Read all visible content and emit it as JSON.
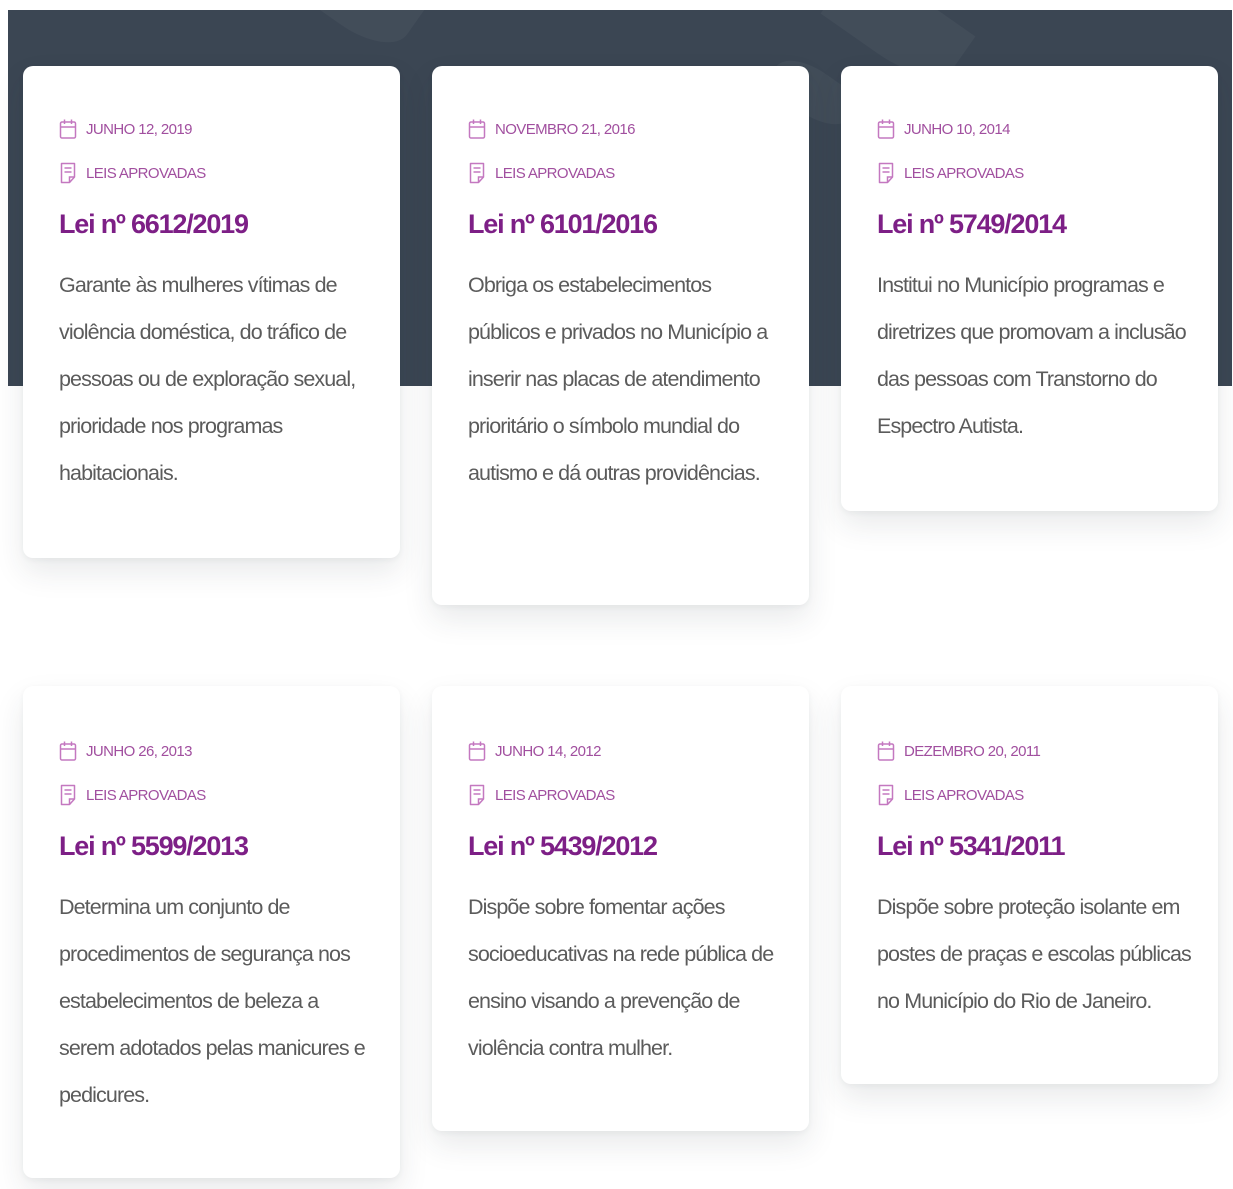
{
  "cards": [
    {
      "date": "JUNHO 12, 2019",
      "category": "LEIS APROVADAS",
      "title": "Lei nº 6612/2019",
      "excerpt": "Garante às mulheres vítimas de violência doméstica, do tráfico de pessoas ou de exploração sexual, prioridade nos programas habitacionais."
    },
    {
      "date": "NOVEMBRO 21, 2016",
      "category": "LEIS APROVADAS",
      "title": "Lei nº 6101/2016",
      "excerpt": "Obriga os estabelecimentos públicos e privados no Município a inserir nas placas de atendimento prioritário o símbolo mundial do autismo e dá outras providências."
    },
    {
      "date": "JUNHO 10, 2014",
      "category": "LEIS APROVADAS",
      "title": "Lei nº 5749/2014",
      "excerpt": "Institui no Município programas e diretrizes que promovam a inclusão das pessoas com Transtorno do Espectro Autista."
    },
    {
      "date": "JUNHO 26, 2013",
      "category": "LEIS APROVADAS",
      "title": "Lei nº 5599/2013",
      "excerpt": "Determina um conjunto de procedimentos de segurança nos estabelecimentos de beleza a serem adotados pelas manicures e pedicures."
    },
    {
      "date": "JUNHO 14, 2012",
      "category": "LEIS APROVADAS",
      "title": "Lei nº 5439/2012",
      "excerpt": "Dispõe sobre fomentar ações socioeducativas na rede pública de ensino visando a prevenção de violência contra mulher."
    },
    {
      "date": "DEZEMBRO 20, 2011",
      "category": "LEIS APROVADAS",
      "title": "Lei nº 5341/2011",
      "excerpt": "Dispõe sobre proteção isolante em postes de praças e escolas públicas no Município do Rio de Janeiro."
    }
  ],
  "icons": {
    "date": "calendar-icon",
    "category": "document-icon"
  },
  "colors": {
    "header_background": "#3b4653",
    "meta_text": "#a14f9f",
    "title": "#7d1f86",
    "body_text": "#5b5b5b",
    "card_background": "#ffffff"
  }
}
